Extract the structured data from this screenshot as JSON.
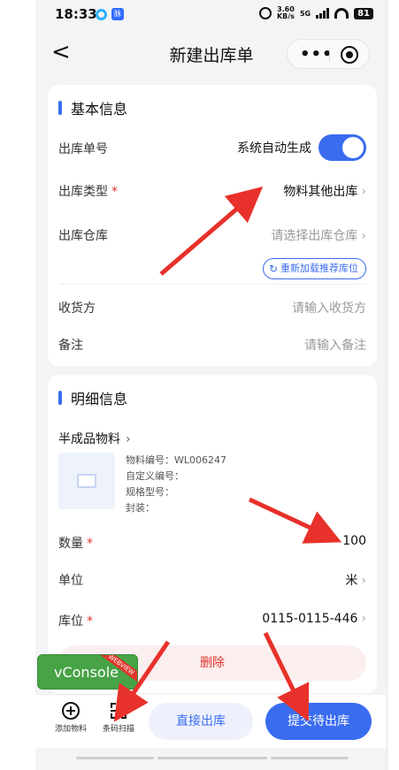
{
  "status_bar": {
    "time": "18:33",
    "app_badge": "脉",
    "net_speed": "3.60",
    "net_unit": "KB/s",
    "network": "5G",
    "battery": "81"
  },
  "nav": {
    "back": "<",
    "title": "新建出库单",
    "more": "•••"
  },
  "basic": {
    "title": "基本信息",
    "order_no": {
      "label": "出库单号",
      "value": "系统自动生成"
    },
    "type": {
      "label": "出库类型",
      "value": "物料其他出库"
    },
    "warehouse": {
      "label": "出库仓库",
      "placeholder": "请选择出库仓库"
    },
    "reload_label": "重新加载推荐库位",
    "receiver": {
      "label": "收货方",
      "placeholder": "请输入收货方"
    },
    "remark": {
      "label": "备注",
      "placeholder": "请输入备注"
    }
  },
  "detail": {
    "title": "明细信息",
    "category": "半成品物料",
    "item": {
      "code": "物料编号：WL006247",
      "custom_code": "自定义编号：",
      "spec": "规格型号：",
      "package": "封装："
    },
    "quantity": {
      "label": "数量",
      "value": "100"
    },
    "unit": {
      "label": "单位",
      "value": "米"
    },
    "location": {
      "label": "库位",
      "value": "0115-0115-446"
    },
    "delete_label": "删除"
  },
  "vconsole": {
    "label": "vConsole",
    "ribbon": "WEBVIEW"
  },
  "bottom": {
    "add_material": "添加物料",
    "scan": "条码扫描",
    "direct_out": "直接出库",
    "submit": "提交待出库"
  },
  "colors": {
    "accent": "#3a6cf0",
    "danger": "#e0362c",
    "vconsole": "#47a346"
  },
  "icons": [
    "back-icon",
    "more-icon",
    "close-mini-program-icon",
    "chevron-right-icon",
    "refresh-icon",
    "image-placeholder-icon",
    "add-circle-icon",
    "scan-icon"
  ]
}
